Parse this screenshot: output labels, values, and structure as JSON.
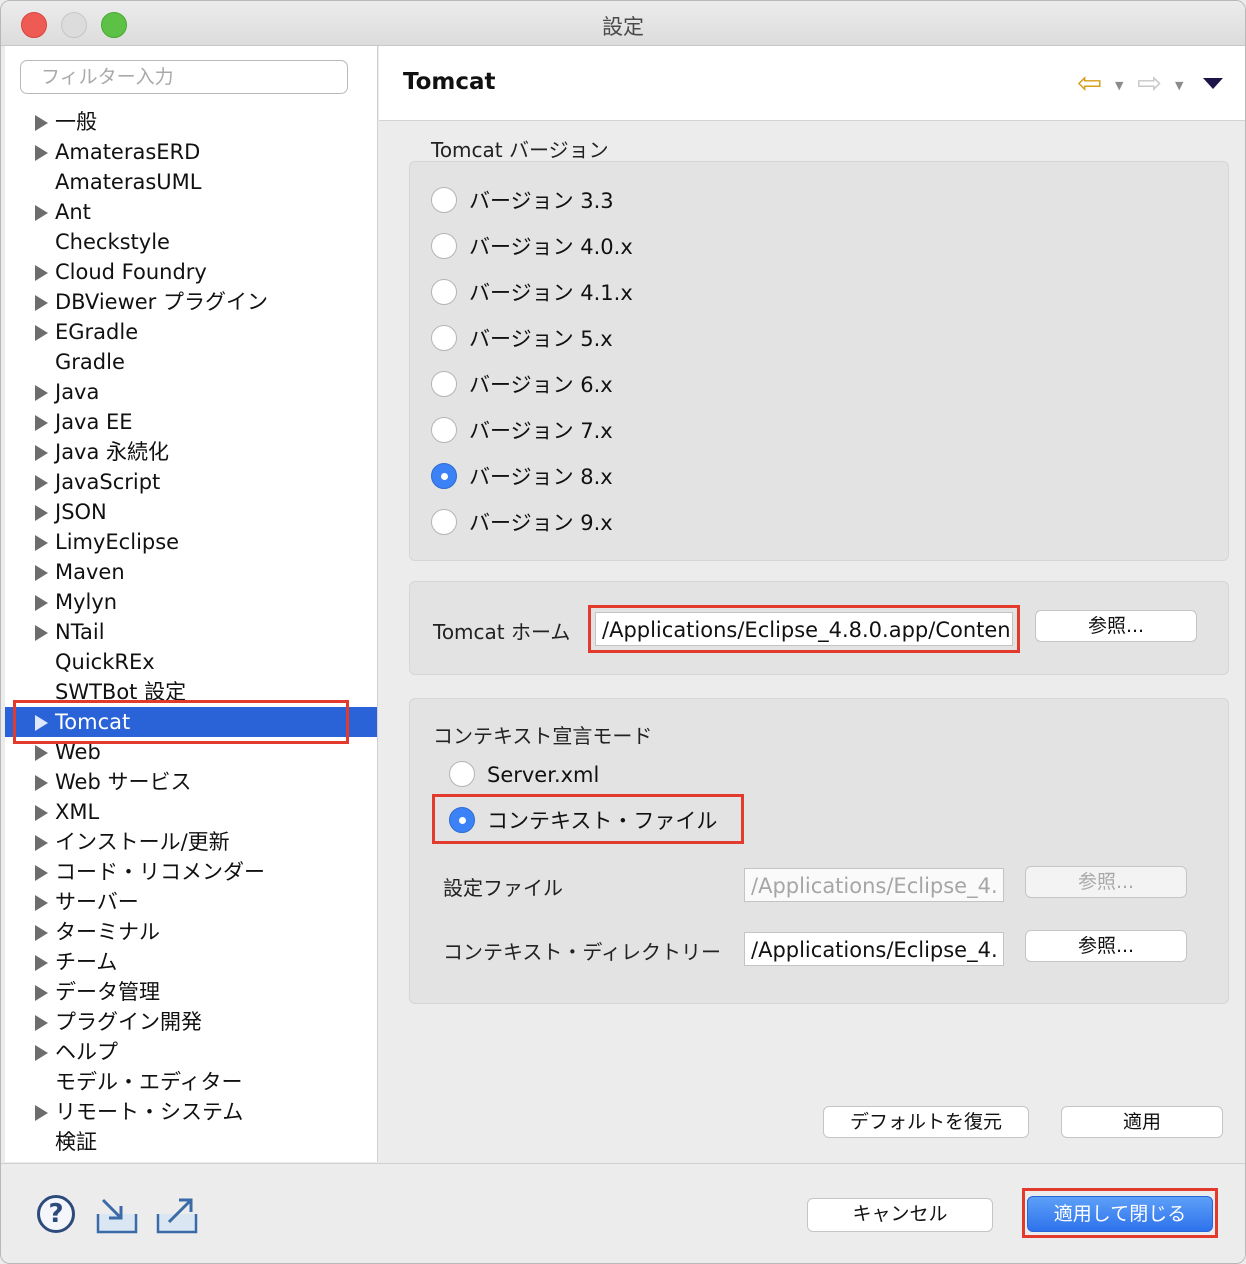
{
  "window": {
    "title": "設定"
  },
  "sidebar": {
    "filter_placeholder": "フィルター入力",
    "items": [
      {
        "label": "一般",
        "expandable": true
      },
      {
        "label": "AmaterasERD",
        "expandable": true
      },
      {
        "label": "AmaterasUML",
        "expandable": false
      },
      {
        "label": "Ant",
        "expandable": true
      },
      {
        "label": "Checkstyle",
        "expandable": false
      },
      {
        "label": "Cloud Foundry",
        "expandable": true
      },
      {
        "label": "DBViewer プラグイン",
        "expandable": true
      },
      {
        "label": "EGradle",
        "expandable": true
      },
      {
        "label": "Gradle",
        "expandable": false
      },
      {
        "label": "Java",
        "expandable": true
      },
      {
        "label": "Java EE",
        "expandable": true
      },
      {
        "label": "Java 永続化",
        "expandable": true
      },
      {
        "label": "JavaScript",
        "expandable": true
      },
      {
        "label": "JSON",
        "expandable": true
      },
      {
        "label": "LimyEclipse",
        "expandable": true
      },
      {
        "label": "Maven",
        "expandable": true
      },
      {
        "label": "Mylyn",
        "expandable": true
      },
      {
        "label": "NTail",
        "expandable": true
      },
      {
        "label": "QuickREx",
        "expandable": false
      },
      {
        "label": "SWTBot 設定",
        "expandable": false
      },
      {
        "label": "Tomcat",
        "expandable": true,
        "selected": true
      },
      {
        "label": "Web",
        "expandable": true
      },
      {
        "label": "Web サービス",
        "expandable": true
      },
      {
        "label": "XML",
        "expandable": true
      },
      {
        "label": "インストール/更新",
        "expandable": true
      },
      {
        "label": "コード・リコメンダー",
        "expandable": true
      },
      {
        "label": "サーバー",
        "expandable": true
      },
      {
        "label": "ターミナル",
        "expandable": true
      },
      {
        "label": "チーム",
        "expandable": true
      },
      {
        "label": "データ管理",
        "expandable": true
      },
      {
        "label": "プラグイン開発",
        "expandable": true
      },
      {
        "label": "ヘルプ",
        "expandable": true
      },
      {
        "label": "モデル・エディター",
        "expandable": false
      },
      {
        "label": "リモート・システム",
        "expandable": true
      },
      {
        "label": "検証",
        "expandable": false
      }
    ]
  },
  "page": {
    "title": "Tomcat",
    "version_group": {
      "title": "Tomcat バージョン",
      "options": [
        {
          "label": "バージョン 3.3",
          "selected": false
        },
        {
          "label": "バージョン 4.0.x",
          "selected": false
        },
        {
          "label": "バージョン 4.1.x",
          "selected": false
        },
        {
          "label": "バージョン 5.x",
          "selected": false
        },
        {
          "label": "バージョン 6.x",
          "selected": false
        },
        {
          "label": "バージョン 7.x",
          "selected": false
        },
        {
          "label": "バージョン 8.x",
          "selected": true
        },
        {
          "label": "バージョン 9.x",
          "selected": false
        }
      ]
    },
    "home": {
      "label": "Tomcat ホーム",
      "value": "/Applications/Eclipse_4.8.0.app/Conten",
      "browse": "参照..."
    },
    "context": {
      "title": "コンテキスト宣言モード",
      "options": [
        {
          "label": "Server.xml",
          "selected": false
        },
        {
          "label": "コンテキスト・ファイル",
          "selected": true
        }
      ],
      "config_file_label": "設定ファイル",
      "config_file_value": "/Applications/Eclipse_4.",
      "config_browse": "参照...",
      "dir_label": "コンテキスト・ディレクトリー",
      "dir_value": "/Applications/Eclipse_4.",
      "dir_browse": "参照..."
    },
    "restore_defaults": "デフォルトを復元",
    "apply": "適用"
  },
  "footer": {
    "cancel": "キャンセル",
    "apply_close": "適用して閉じる"
  },
  "colors": {
    "selection": "#2a63d8",
    "highlight_box": "#e23b2e",
    "radio_on": "#3b82f6",
    "back_arrow": "#d59e1c"
  }
}
